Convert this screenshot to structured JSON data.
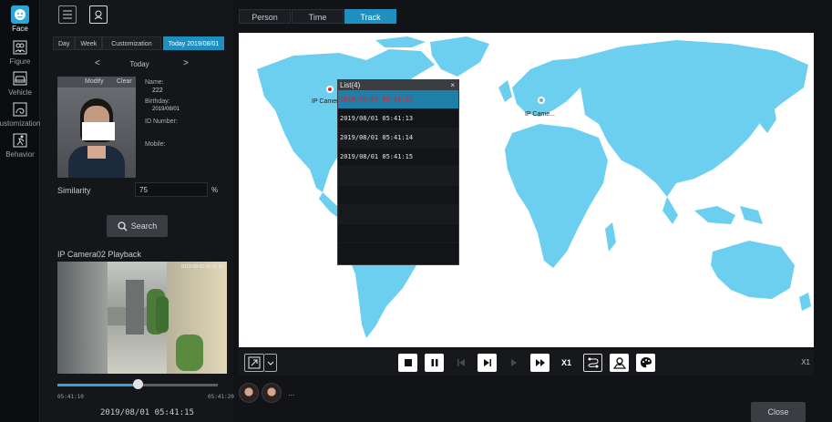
{
  "sidebar": {
    "items": [
      {
        "label": "Face",
        "icon": "face-icon",
        "active": true
      },
      {
        "label": "Figure",
        "icon": "figure-icon",
        "active": false
      },
      {
        "label": "Vehicle",
        "icon": "vehicle-icon",
        "active": false
      },
      {
        "label": "ustomization",
        "icon": "customization-icon",
        "active": false
      },
      {
        "label": "Behavior",
        "icon": "behavior-icon",
        "active": false
      }
    ]
  },
  "left": {
    "tool_icons": [
      "list-view-icon",
      "face-search-icon"
    ],
    "period_tabs": [
      "Day",
      "Week",
      "Customization"
    ],
    "date_tab": "Today 2019/08/01",
    "day_nav": {
      "prev": "<",
      "current": "Today",
      "next": ">"
    },
    "face_card": {
      "modify": "Modify",
      "clear": "Clear"
    },
    "info": {
      "name_label": "Name:",
      "name_value": "222",
      "birthday_label": "Birthday:",
      "birthday_value": "2019/08/01",
      "id_label": "ID Number:",
      "mobile_label": "Mobile:"
    },
    "similarity_label": "Similarity",
    "similarity_value": "75",
    "similarity_unit": "%",
    "search_label": "Search",
    "playback_title": "IP Camera02 Playback",
    "time_start": "05:41:10",
    "time_end": "05:41:20",
    "time_current": "2019/08/01 05:41:15",
    "video_osd": "2019-08-01 05:41:15",
    "progress_fraction": 0.5
  },
  "main": {
    "tabs": [
      {
        "label": "Person",
        "active": false
      },
      {
        "label": "Time",
        "active": false
      },
      {
        "label": "Track",
        "active": true
      }
    ],
    "map": {
      "ocean_color": "#ffffff",
      "land_color": "#6ccff0",
      "pins": [
        {
          "label": "IP Camera02",
          "color": "#d9263a"
        },
        {
          "label": "IP Came...",
          "color": "#8aa0b0"
        }
      ]
    },
    "popup": {
      "title": "List(4)",
      "close": "×",
      "rows": [
        "2019/08/01 05:41:12",
        "2019/08/01 05:41:13",
        "2019/08/01 05:41:14",
        "2019/08/01 05:41:15"
      ]
    },
    "controls": {
      "speed_button": "X1",
      "speed_text": "X1"
    },
    "thumbs_more": "...",
    "close_label": "Close"
  }
}
